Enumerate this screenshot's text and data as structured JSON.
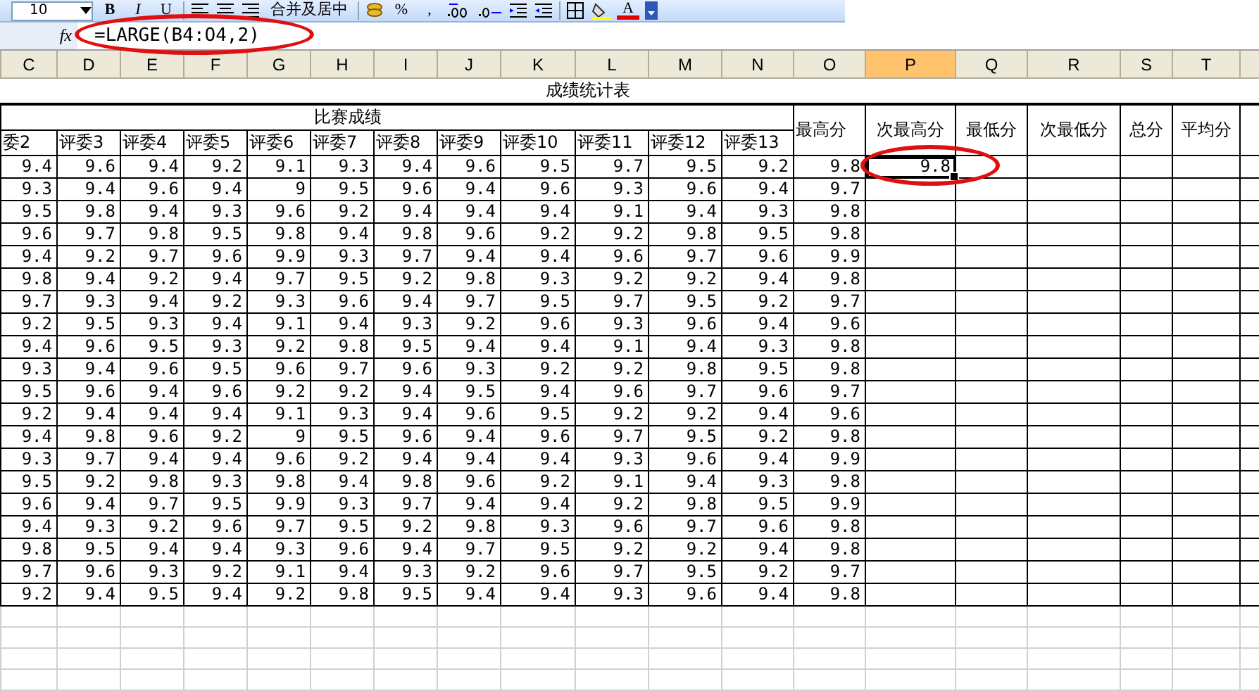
{
  "toolbar": {
    "font_size": "10",
    "buttons": [
      {
        "kind": "bold",
        "label": "B"
      },
      {
        "kind": "italic",
        "label": "I"
      },
      {
        "kind": "underline",
        "label": "U"
      },
      {
        "kind": "align-left"
      },
      {
        "kind": "align-center"
      },
      {
        "kind": "align-right"
      },
      {
        "kind": "merge",
        "label": "合并及居中"
      },
      {
        "kind": "currency"
      },
      {
        "kind": "percent",
        "label": "%"
      },
      {
        "kind": "comma",
        "label": ","
      },
      {
        "kind": "increase-decimal"
      },
      {
        "kind": "decrease-decimal"
      },
      {
        "kind": "outdent"
      },
      {
        "kind": "indent"
      },
      {
        "kind": "borders"
      },
      {
        "kind": "fill-color"
      },
      {
        "kind": "font-color",
        "label": "A"
      },
      {
        "kind": "options"
      }
    ]
  },
  "formula_bar": {
    "fx": "fx",
    "formula": "=LARGE(B4:O4,2)",
    "circled": true
  },
  "column_headers": [
    {
      "label": "C",
      "selected": false
    },
    {
      "label": "D",
      "selected": false
    },
    {
      "label": "E",
      "selected": false
    },
    {
      "label": "F",
      "selected": false
    },
    {
      "label": "G",
      "selected": false
    },
    {
      "label": "H",
      "selected": false
    },
    {
      "label": "I",
      "selected": false
    },
    {
      "label": "J",
      "selected": false
    },
    {
      "label": "K",
      "selected": false
    },
    {
      "label": "L",
      "selected": false
    },
    {
      "label": "M",
      "selected": false
    },
    {
      "label": "N",
      "selected": false
    },
    {
      "label": "O",
      "selected": false
    },
    {
      "label": "P",
      "selected": true
    },
    {
      "label": "Q",
      "selected": false
    },
    {
      "label": "R",
      "selected": false
    },
    {
      "label": "S",
      "selected": false
    },
    {
      "label": "T",
      "selected": false
    }
  ],
  "sheet": {
    "title": "成绩统计表",
    "group_header": "比赛成绩",
    "judge_headers": [
      "委2",
      "评委3",
      "评委4",
      "评委5",
      "评委6",
      "评委7",
      "评委8",
      "评委9",
      "评委10",
      "评委11",
      "评委12",
      "评委13"
    ],
    "stat_headers": [
      "最高分",
      "次最高分",
      "最低分",
      "次最低分",
      "总分",
      "平均分"
    ],
    "rows": [
      {
        "scores": [
          "9.4",
          "9.6",
          "9.4",
          "9.2",
          "9.1",
          "9.3",
          "9.4",
          "9.6",
          "9.5",
          "9.7",
          "9.5",
          "9.2"
        ],
        "max": "9.8",
        "second_max": {
          "value": "9.8",
          "selected": true,
          "circled": true
        }
      },
      {
        "scores": [
          "9.3",
          "9.4",
          "9.6",
          "9.4",
          "9",
          "9.5",
          "9.6",
          "9.4",
          "9.6",
          "9.3",
          "9.6",
          "9.4"
        ],
        "max": "9.7"
      },
      {
        "scores": [
          "9.5",
          "9.8",
          "9.4",
          "9.3",
          "9.6",
          "9.2",
          "9.4",
          "9.4",
          "9.4",
          "9.1",
          "9.4",
          "9.3"
        ],
        "max": "9.8"
      },
      {
        "scores": [
          "9.6",
          "9.7",
          "9.8",
          "9.5",
          "9.8",
          "9.4",
          "9.8",
          "9.6",
          "9.2",
          "9.2",
          "9.8",
          "9.5"
        ],
        "max": "9.8"
      },
      {
        "scores": [
          "9.4",
          "9.2",
          "9.7",
          "9.6",
          "9.9",
          "9.3",
          "9.7",
          "9.4",
          "9.4",
          "9.6",
          "9.7",
          "9.6"
        ],
        "max": "9.9"
      },
      {
        "scores": [
          "9.8",
          "9.4",
          "9.2",
          "9.4",
          "9.7",
          "9.5",
          "9.2",
          "9.8",
          "9.3",
          "9.2",
          "9.2",
          "9.4"
        ],
        "max": "9.8"
      },
      {
        "scores": [
          "9.7",
          "9.3",
          "9.4",
          "9.2",
          "9.3",
          "9.6",
          "9.4",
          "9.7",
          "9.5",
          "9.7",
          "9.5",
          "9.2"
        ],
        "max": "9.7"
      },
      {
        "scores": [
          "9.2",
          "9.5",
          "9.3",
          "9.4",
          "9.1",
          "9.4",
          "9.3",
          "9.2",
          "9.6",
          "9.3",
          "9.6",
          "9.4"
        ],
        "max": "9.6"
      },
      {
        "scores": [
          "9.4",
          "9.6",
          "9.5",
          "9.3",
          "9.2",
          "9.8",
          "9.5",
          "9.4",
          "9.4",
          "9.1",
          "9.4",
          "9.3"
        ],
        "max": "9.8"
      },
      {
        "scores": [
          "9.3",
          "9.4",
          "9.6",
          "9.5",
          "9.6",
          "9.7",
          "9.6",
          "9.3",
          "9.2",
          "9.2",
          "9.8",
          "9.5"
        ],
        "max": "9.8"
      },
      {
        "scores": [
          "9.5",
          "9.6",
          "9.4",
          "9.6",
          "9.2",
          "9.2",
          "9.4",
          "9.5",
          "9.4",
          "9.6",
          "9.7",
          "9.6"
        ],
        "max": "9.7"
      },
      {
        "scores": [
          "9.2",
          "9.4",
          "9.4",
          "9.4",
          "9.1",
          "9.3",
          "9.4",
          "9.6",
          "9.5",
          "9.2",
          "9.2",
          "9.4"
        ],
        "max": "9.6"
      },
      {
        "scores": [
          "9.4",
          "9.8",
          "9.6",
          "9.2",
          "9",
          "9.5",
          "9.6",
          "9.4",
          "9.6",
          "9.7",
          "9.5",
          "9.2"
        ],
        "max": "9.8"
      },
      {
        "scores": [
          "9.3",
          "9.7",
          "9.4",
          "9.4",
          "9.6",
          "9.2",
          "9.4",
          "9.4",
          "9.4",
          "9.3",
          "9.6",
          "9.4"
        ],
        "max": "9.9"
      },
      {
        "scores": [
          "9.5",
          "9.2",
          "9.8",
          "9.3",
          "9.8",
          "9.4",
          "9.8",
          "9.6",
          "9.2",
          "9.1",
          "9.4",
          "9.3"
        ],
        "max": "9.8"
      },
      {
        "scores": [
          "9.6",
          "9.4",
          "9.7",
          "9.5",
          "9.9",
          "9.3",
          "9.7",
          "9.4",
          "9.4",
          "9.2",
          "9.8",
          "9.5"
        ],
        "max": "9.9"
      },
      {
        "scores": [
          "9.4",
          "9.3",
          "9.2",
          "9.6",
          "9.7",
          "9.5",
          "9.2",
          "9.8",
          "9.3",
          "9.6",
          "9.7",
          "9.6"
        ],
        "max": "9.8"
      },
      {
        "scores": [
          "9.8",
          "9.5",
          "9.4",
          "9.4",
          "9.3",
          "9.6",
          "9.4",
          "9.7",
          "9.5",
          "9.2",
          "9.2",
          "9.4"
        ],
        "max": "9.8"
      },
      {
        "scores": [
          "9.7",
          "9.6",
          "9.3",
          "9.2",
          "9.1",
          "9.4",
          "9.3",
          "9.2",
          "9.6",
          "9.7",
          "9.5",
          "9.2"
        ],
        "max": "9.7"
      },
      {
        "scores": [
          "9.2",
          "9.4",
          "9.5",
          "9.4",
          "9.2",
          "9.8",
          "9.5",
          "9.4",
          "9.4",
          "9.3",
          "9.6",
          "9.4"
        ],
        "max": "9.8"
      }
    ]
  }
}
